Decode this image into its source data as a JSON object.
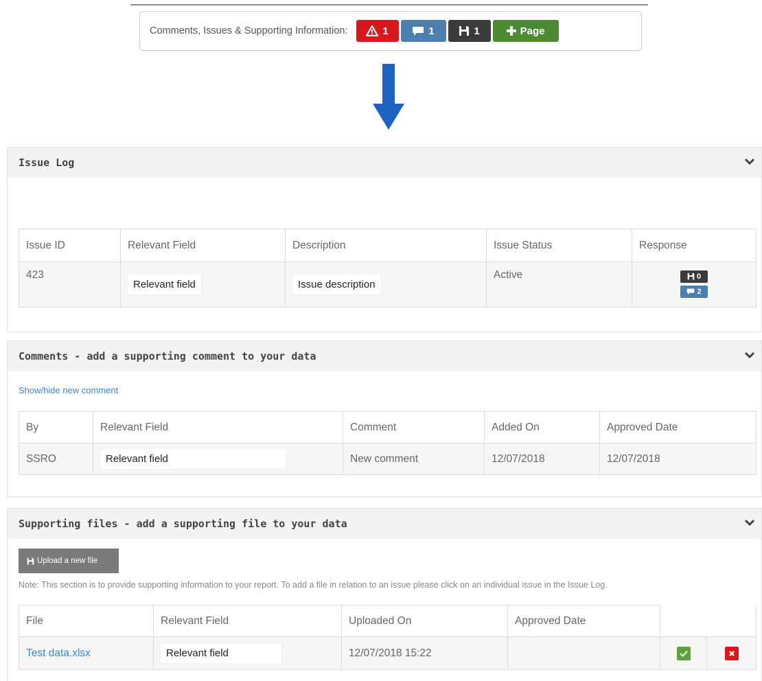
{
  "summary": {
    "label": "Comments, Issues & Supporting Information:",
    "issues_count": "1",
    "comments_count": "1",
    "files_count": "1",
    "add_page_label": "Page"
  },
  "colors": {
    "issue_red": "#d8191c",
    "comment_blue": "#4c7fae",
    "file_dark": "#3b3b3b",
    "add_green": "#4d8a34",
    "arrow_blue": "#1f63c0",
    "link_blue": "#3b87c9"
  },
  "issue_log": {
    "title": "Issue Log",
    "headers": [
      "Issue ID",
      "Relevant Field",
      "Description",
      "Issue Status",
      "Response"
    ],
    "rows": [
      {
        "id": "423",
        "field": "Relevant field",
        "description": "Issue description",
        "status": "Active",
        "response_files": "0",
        "response_comments": "2"
      }
    ]
  },
  "comments": {
    "title": "Comments - add a supporting comment to your data",
    "toggle_link": "Show/hide new comment",
    "headers": [
      "By",
      "Relevant Field",
      "Comment",
      "Added On",
      "Approved Date"
    ],
    "rows": [
      {
        "by": "SSRO",
        "field": "Relevant field",
        "comment": "New comment",
        "added_on": "12/07/2018",
        "approved_date": "12/07/2018"
      }
    ]
  },
  "supporting_files": {
    "title": "Supporting files - add a supporting file to your data",
    "upload_label": "Upload a new file",
    "note": "Note: This section is to provide supporting information to your report. To add a file in relation to an issue please click on an individual issue in the Issue Log.",
    "headers": [
      "File",
      "Relevant Field",
      "Uploaded On",
      "Approved Date"
    ],
    "rows": [
      {
        "file": "Test data.xlsx",
        "field": "Relevant field",
        "uploaded_on": "12/07/2018 15:22",
        "approved_date": ""
      }
    ]
  }
}
